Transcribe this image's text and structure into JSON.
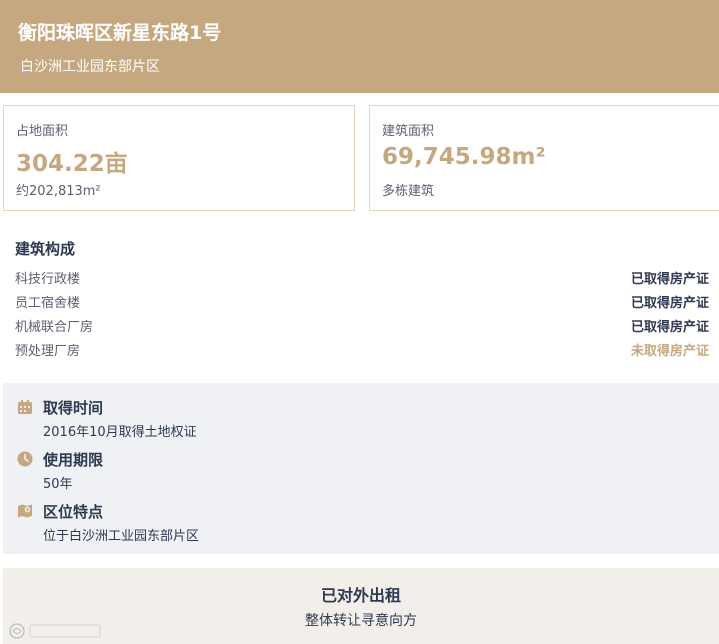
{
  "header": {
    "title": "衡阳珠晖区新星东路1号",
    "subtitle": "白沙洲工业园东部片区"
  },
  "stats": {
    "land": {
      "label": "占地面积",
      "value": "304.22亩",
      "note": "约202,813m²"
    },
    "building": {
      "label": "建筑面积",
      "value": "69,745.98m²",
      "note": "多栋建筑"
    }
  },
  "composition": {
    "title": "建筑构成",
    "rows": [
      {
        "name": "科技行政楼",
        "status": "已取得房产证"
      },
      {
        "name": "员工宿舍楼",
        "status": "已取得房产证"
      },
      {
        "name": "机械联合厂房",
        "status": "已取得房产证"
      },
      {
        "name": "预处理厂房",
        "status": "未取得房产证"
      }
    ]
  },
  "info": {
    "items": [
      {
        "icon": "calendar-icon",
        "label": "取得时间",
        "value": "2016年10月取得土地权证"
      },
      {
        "icon": "clock-icon",
        "label": "使用期限",
        "value": "50年"
      },
      {
        "icon": "map-pin-icon",
        "label": "区位特点",
        "value": "位于白沙洲工业园东部片区"
      }
    ]
  },
  "footer": {
    "line1": "已对外出租",
    "line2": "整体转让寻意向方"
  },
  "colors": {
    "brand": "#c6a880",
    "text_dark": "#2f3a52",
    "status_ok": "#2f3a52",
    "status_pending": "#c6a880"
  }
}
